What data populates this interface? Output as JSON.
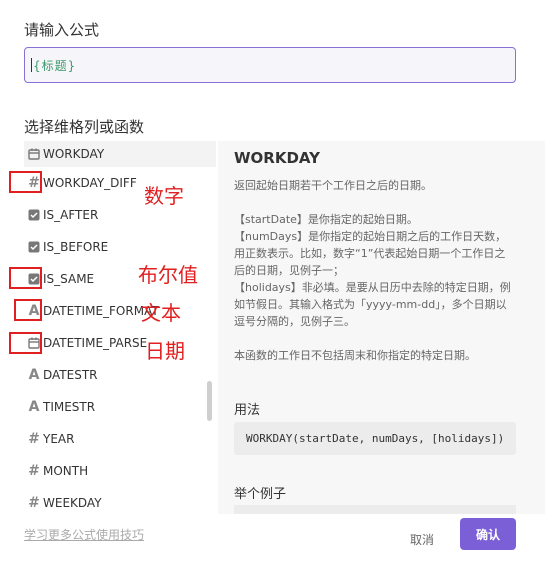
{
  "dialog": {
    "title": "请输入公式",
    "formula_value": "{标题}",
    "section_title": "选择维格列或函数"
  },
  "function_list": [
    {
      "icon": "calendar-icon",
      "label": "WORKDAY",
      "selected": true
    },
    {
      "icon": "hash-icon",
      "label": "WORKDAY_DIFF"
    },
    {
      "icon": "checkbox-icon",
      "label": "IS_AFTER"
    },
    {
      "icon": "checkbox-icon",
      "label": "IS_BEFORE"
    },
    {
      "icon": "checkbox-icon",
      "label": "IS_SAME"
    },
    {
      "icon": "text-a-icon",
      "label": "DATETIME_FORMAT"
    },
    {
      "icon": "calendar-icon",
      "label": "DATETIME_PARSE"
    },
    {
      "icon": "text-a-icon",
      "label": "DATESTR"
    },
    {
      "icon": "text-a-icon",
      "label": "TIMESTR"
    },
    {
      "icon": "hash-icon",
      "label": "YEAR"
    },
    {
      "icon": "hash-icon",
      "label": "MONTH"
    },
    {
      "icon": "hash-icon",
      "label": "WEEKDAY"
    }
  ],
  "detail": {
    "name": "WORKDAY",
    "desc_1": "返回起始日期若干个工作日之后的日期。",
    "desc_2": "【startDate】是你指定的起始日期。",
    "desc_3": "【numDays】是你指定的起始日期之后的工作日天数，用正数表示。比如，数字“1”代表起始日期一个工作日之后的日期，见例子一；",
    "desc_4": "【holidays】非必填。是要从日历中去除的特定日期，例如节假日。其输入格式为「yyyy-mm-dd」，多个日期以逗号分隔的，见例子三。",
    "desc_5": "本函数的工作日不包括周末和你指定的特定日期。",
    "usage_heading": "用法",
    "usage_code": "WORKDAY(startDate, numDays, [holidays])",
    "example_heading": "举个例子"
  },
  "footer": {
    "tips_link": "学习更多公式使用技巧",
    "cancel_label": "取消",
    "ok_label": "确认"
  },
  "annotations": {
    "number": "数字",
    "boolean": "布尔值",
    "text": "文本",
    "date": "日期",
    "color": "#e02020"
  },
  "colors": {
    "accent": "#7b5fd6",
    "formula_tag": "#3e9a6a"
  }
}
